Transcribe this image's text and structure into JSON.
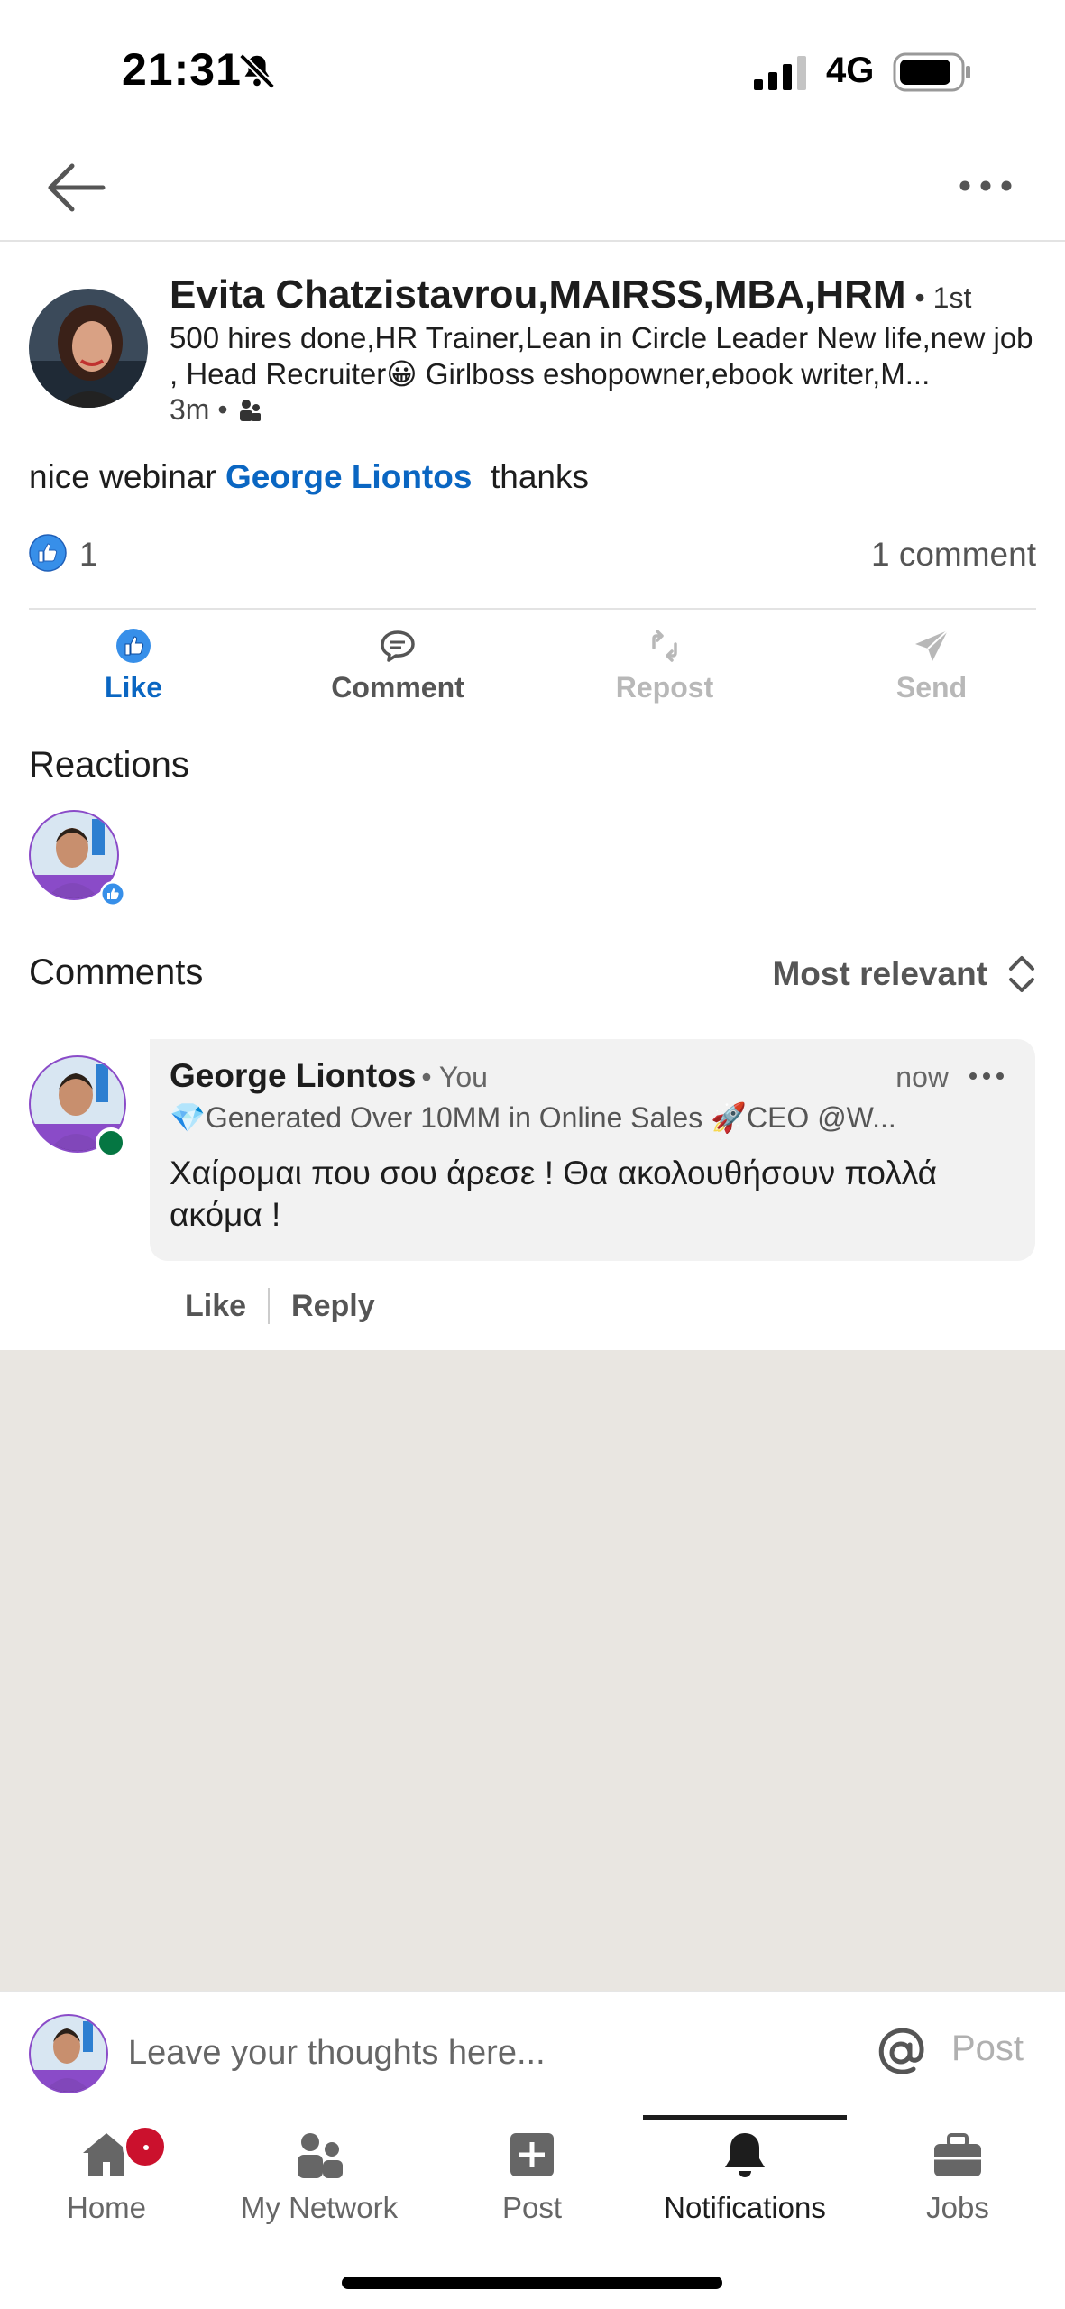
{
  "status_bar": {
    "time": "21:31",
    "network": "4G",
    "icons": [
      "bell-off-icon",
      "signal-icon",
      "battery-icon"
    ]
  },
  "top_nav": {
    "icons": [
      "back-arrow-icon",
      "more-dots-icon"
    ]
  },
  "post": {
    "author_name": "Evita Chatzistavrou,MAIRSS,MBA,HRM",
    "author_degree": "• 1st",
    "author_headline": "500 hires done,HR Trainer,Lean in Circle Leader New life,new job , Head Recruiter😀 Girlboss eshopowner,ebook writer,M...",
    "time_ago": "3m •",
    "audience_icon": "connections-icon",
    "text_before": "nice webinar ",
    "mention": "George Liontos",
    "text_after": "  thanks",
    "reaction_count": "1",
    "comment_count": "1 comment"
  },
  "actions": {
    "like": "Like",
    "comment": "Comment",
    "repost": "Repost",
    "send": "Send"
  },
  "reactions": {
    "title": "Reactions"
  },
  "comments": {
    "title": "Comments",
    "sort_label": "Most relevant",
    "items": [
      {
        "author": "George Liontos",
        "badge": "• You",
        "time": "now",
        "headline": "💎Generated Over 10MM in Online Sales 🚀CEO @W...",
        "text": "Χαίρομαι που σου άρεσε ! Θα ακολουθήσουν πολλά ακόμα !",
        "like_label": "Like",
        "reply_label": "Reply"
      }
    ]
  },
  "composer": {
    "placeholder": "Leave your thoughts here...",
    "post_label": "Post"
  },
  "tabbar": {
    "active": "Notifications",
    "items": [
      {
        "label": "Home",
        "icon": "home-icon"
      },
      {
        "label": "My Network",
        "icon": "network-icon"
      },
      {
        "label": "Post",
        "icon": "post-plus-icon"
      },
      {
        "label": "Notifications",
        "icon": "bell-icon"
      },
      {
        "label": "Jobs",
        "icon": "briefcase-icon"
      }
    ]
  },
  "colors": {
    "brand_blue": "#0a66c2",
    "badge_red": "#cb112d",
    "online_green": "#057642",
    "empty_background": "#e9e6e1",
    "avatar_ring_purple": "#8a4bc8"
  }
}
